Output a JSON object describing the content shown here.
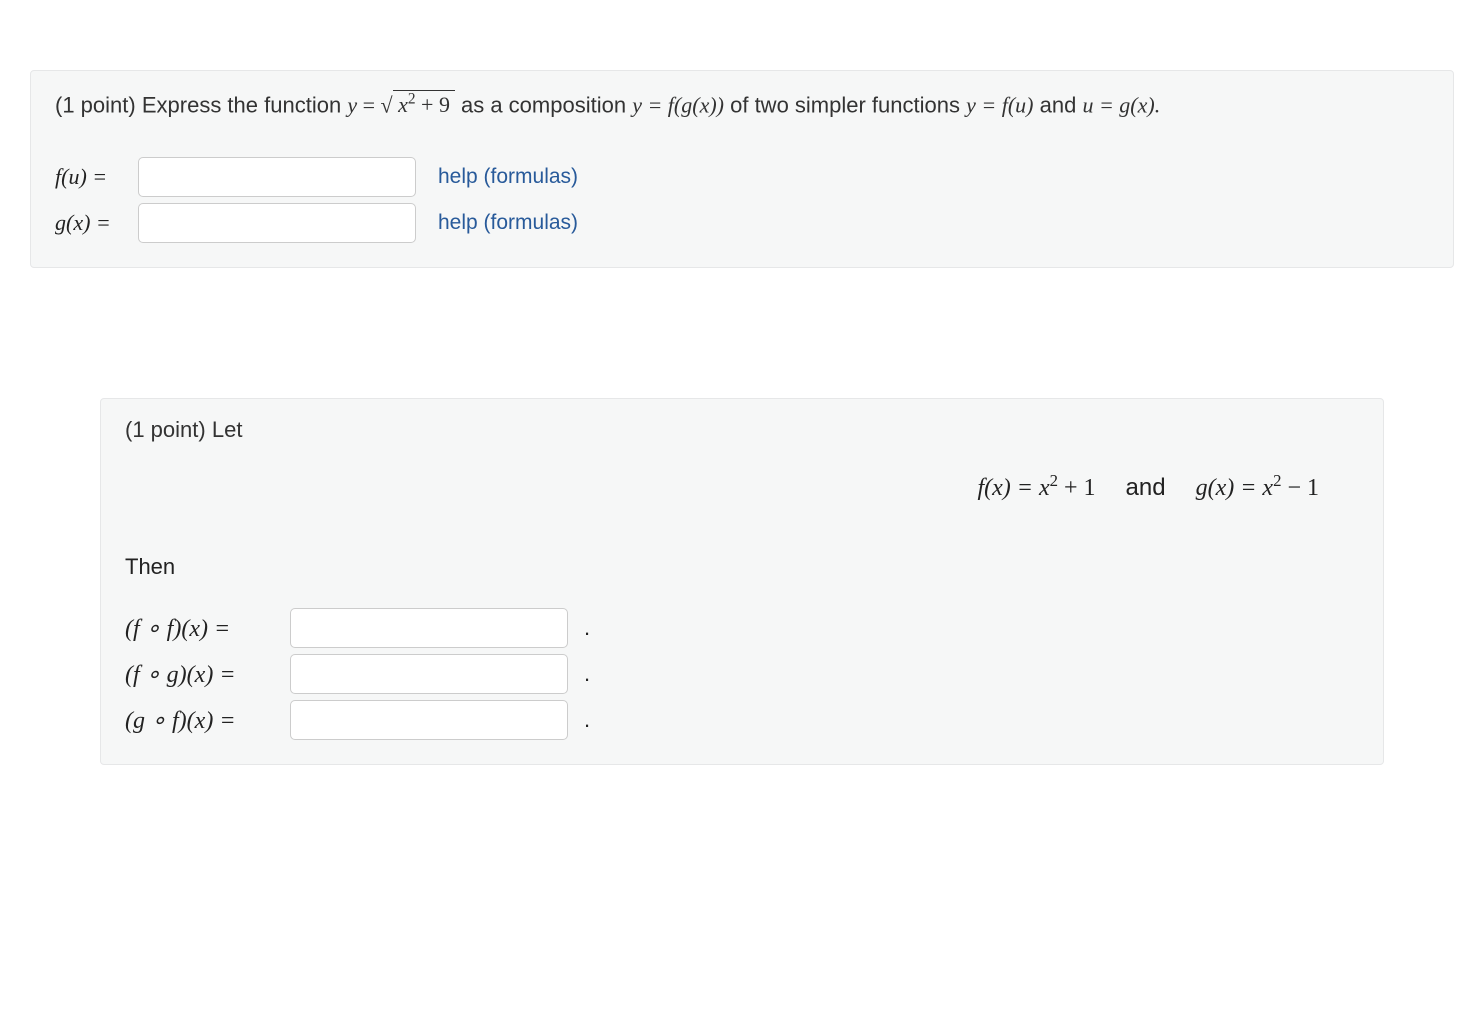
{
  "problem1": {
    "points": "(1 point)",
    "intro1": "Express the function",
    "eq_lhs": "y",
    "eq_rhs_sqrt": "√",
    "eq_radicand_var": "x",
    "eq_radicand_rest": " + 9",
    "intro2": "as a composition",
    "comp_eq": "y = f(g(x))",
    "intro3": "of two simpler functions",
    "fns": "y = f(u)",
    "and": "and",
    "gns": "u = g(x).",
    "fu_label": "f(u) =",
    "gx_label": "g(x) =",
    "help": "help (formulas)"
  },
  "problem2": {
    "points": "(1 point)",
    "let": "Let",
    "def_f_lhs": "f(x) = x",
    "def_f_rhs": " + 1",
    "and": "and",
    "def_g_lhs": "g(x) = x",
    "def_g_rhs": " − 1",
    "then": "Then",
    "ff": "(f ∘ f)(x) =",
    "fg": "(f ∘ g)(x) =",
    "gf": "(g ∘ f)(x) =",
    "period": "."
  }
}
